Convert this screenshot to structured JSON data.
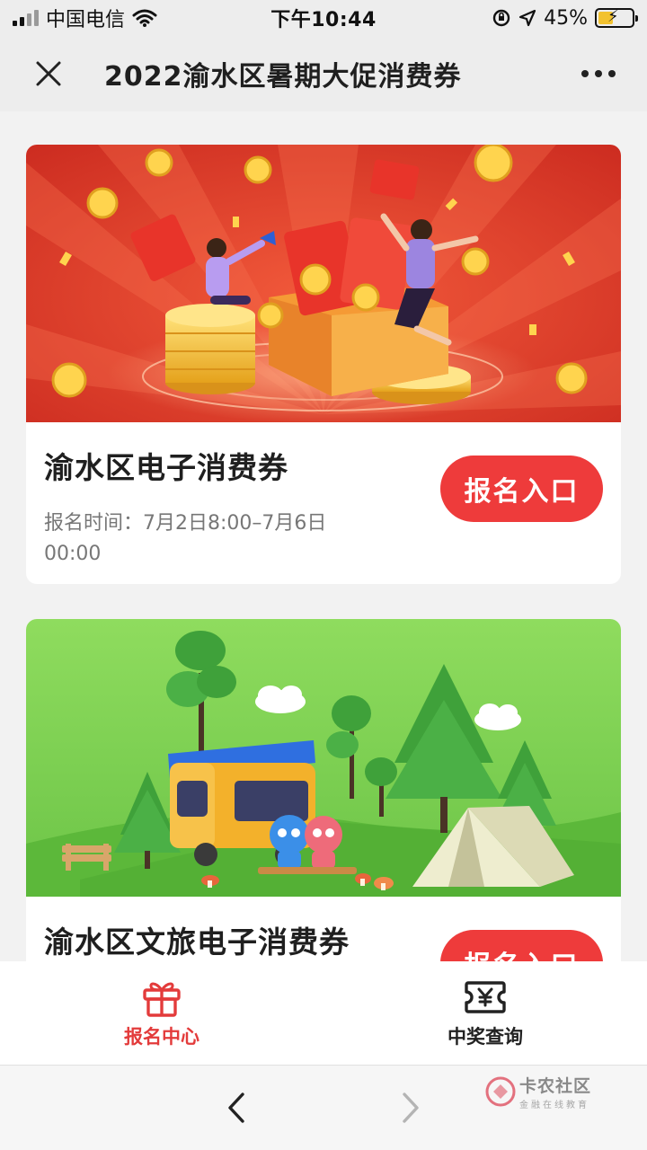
{
  "status_bar": {
    "carrier": "中国电信",
    "time": "下午10:44",
    "battery_percent": "45%",
    "battery_level": 0.45
  },
  "nav": {
    "title": "2022渝水区暑期大促消费券"
  },
  "cards": [
    {
      "title": "渝水区电子消费券",
      "time": "报名时间：7月2日8:00–7月6日00:00",
      "button_label": "报名入口"
    },
    {
      "title": "渝水区文旅电子消费券",
      "button_label": "报名入口"
    }
  ],
  "tabs": [
    {
      "label": "报名中心",
      "icon": "gift-icon",
      "active": true
    },
    {
      "label": "中奖查询",
      "icon": "ticket-yuan-icon",
      "active": false
    }
  ],
  "watermark": {
    "main": "卡农社区",
    "sub": "金融在线教育"
  },
  "colors": {
    "accent_red": "#ee3b3b",
    "tab_active": "#e33b3b",
    "banner_green": "#7dd05a",
    "banner_red": "#d93a2b"
  }
}
